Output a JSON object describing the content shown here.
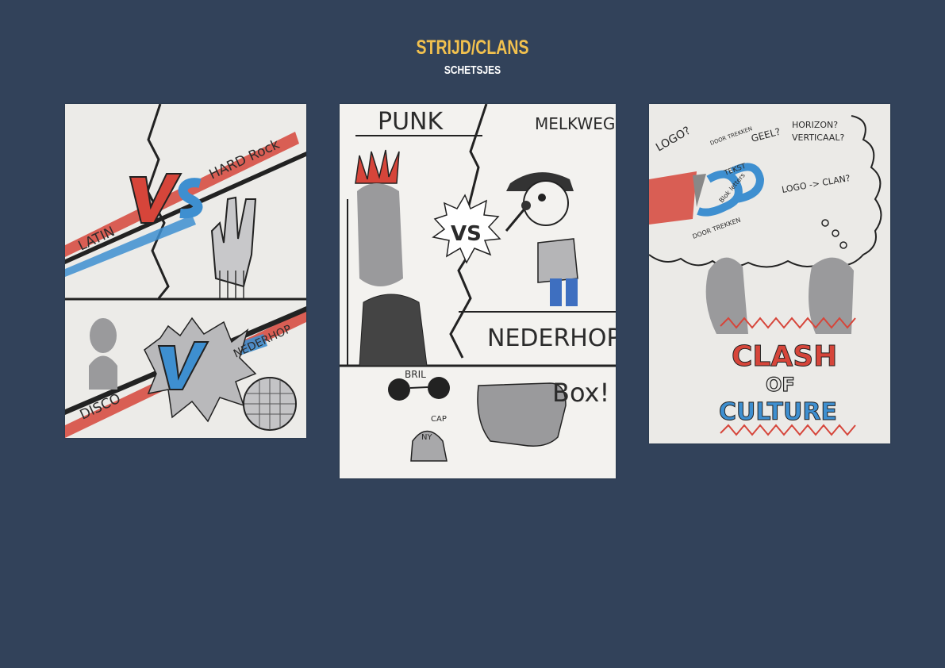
{
  "header": {
    "title": "STRIJD/CLANS",
    "subtitle": "SCHETSJES"
  },
  "sketch1": {
    "latin": "LATIN",
    "hardrock": "HARD Rock",
    "vs": "VS",
    "disco": "DISCO",
    "nederhop": "NEDERHOP"
  },
  "sketch2": {
    "punk": "PUNK",
    "melkweg": "MELKWEG",
    "vs": "VS",
    "nederhop": "NEDERHOP",
    "bril": "BRIL",
    "box": "Box!",
    "cap": "CAP",
    "ny": "NY"
  },
  "sketch3": {
    "logo": "LOGO?",
    "doortrekken_top": "DOOR TREKKEN",
    "geel": "GEEL?",
    "horizon": "HORIZON?",
    "verticaal": "VERTICAAL?",
    "tekst": "TEKST",
    "bloklotters": "Blok letters",
    "logo_clan": "LOGO -> CLAN?",
    "doortrekken_bottom": "DOOR TREKKEN",
    "clash": "CLASH",
    "of": "OF",
    "culture": "CULTURE"
  },
  "colors": {
    "background": "#32425a",
    "title": "#f2c14e",
    "sketch_red": "#d6453a",
    "sketch_blue": "#3e8fd0",
    "marker_gray": "#9a9a9c"
  }
}
